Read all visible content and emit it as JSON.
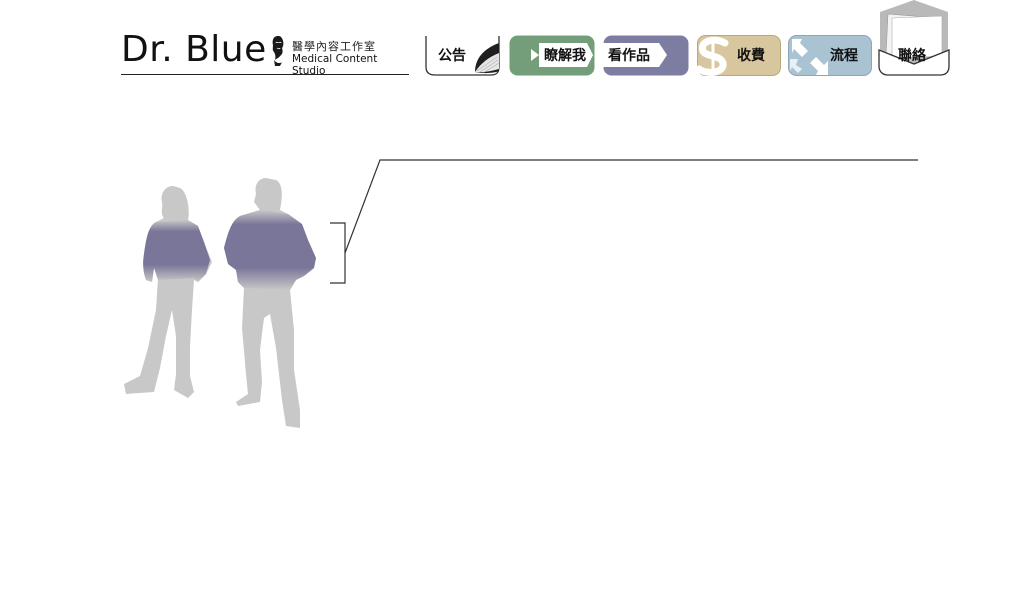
{
  "logo": {
    "main": "Dr. Blue",
    "sub_cn": "醫學內容工作室",
    "sub_en": "Medical Content Studio",
    "face_icon": "portrait-icon"
  },
  "nav": [
    {
      "label": "公告",
      "color": "#ffffff",
      "icon": "page-curl-icon"
    },
    {
      "label": "瞭解我",
      "color": "#6f9a74",
      "icon": "arrow-right-icon"
    },
    {
      "label": "看作品",
      "color": "#78789e",
      "icon": "arrow-right-icon"
    },
    {
      "label": "收費",
      "color": "#d8c79e",
      "icon": "dollar-icon"
    },
    {
      "label": "流程",
      "color": "#a9c3d2",
      "icon": "cycle-arrows-icon"
    },
    {
      "label": "聯絡",
      "color": "#b9b9b9",
      "icon": "envelope-icon"
    }
  ],
  "scene": {
    "figure_gray": "#c8c8c8",
    "shirt_color": "#7a7699",
    "callout_color": "#333333"
  }
}
